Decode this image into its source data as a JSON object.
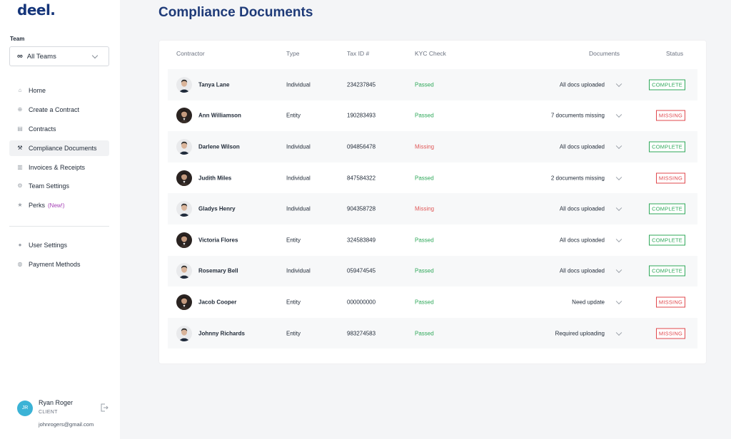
{
  "sidebar": {
    "logo": "deel.",
    "team_label": "Team",
    "team_select": {
      "icon": "∞",
      "value": "All Teams"
    },
    "nav": [
      {
        "label": "Home",
        "icon": "home-icon"
      },
      {
        "label": "Create a Contract",
        "icon": "plus-circle-icon"
      },
      {
        "label": "Contracts",
        "icon": "document-icon"
      },
      {
        "label": "Compliance Documents",
        "icon": "hammer-icon",
        "active": true
      },
      {
        "label": "Invoices & Receipts",
        "icon": "receipt-icon"
      },
      {
        "label": "Team Settings",
        "icon": "gear-icon"
      },
      {
        "label": "Perks",
        "icon": "star-icon",
        "badge": "(New!)"
      }
    ],
    "nav2": [
      {
        "label": "User Settings",
        "icon": "user-icon"
      },
      {
        "label": "Payment Methods",
        "icon": "card-icon"
      }
    ],
    "user": {
      "initials": "JR",
      "name": "Ryan Roger",
      "role": "CLIENT",
      "email": "johnrogers@gmail.com"
    }
  },
  "main": {
    "title": "Compliance Documents",
    "columns": {
      "contractor": "Contractor",
      "type": "Type",
      "tax_id": "Tax ID #",
      "kyc": "KYC Check",
      "documents": "Documents",
      "status": "Status"
    },
    "rows": [
      {
        "name": "Tanya Lane",
        "type": "Individual",
        "tax_id": "234237845",
        "kyc": "Passed",
        "documents": "All docs uploaded",
        "status": "COMPLETE",
        "avatar": "light"
      },
      {
        "name": "Ann Williamson",
        "type": "Entity",
        "tax_id": "190283493",
        "kyc": "Passed",
        "documents": "7 documents missing",
        "status": "MISSING",
        "avatar": "dark"
      },
      {
        "name": "Darlene Wilson",
        "type": "Individual",
        "tax_id": "094856478",
        "kyc": "Missing",
        "documents": "All docs uploaded",
        "status": "COMPLETE",
        "avatar": "light"
      },
      {
        "name": "Judith Miles",
        "type": "Individual",
        "tax_id": "847584322",
        "kyc": "Passed",
        "documents": "2 documents missing",
        "status": "MISSING",
        "avatar": "dark"
      },
      {
        "name": "Gladys Henry",
        "type": "Individual",
        "tax_id": "904358728",
        "kyc": "Missing",
        "documents": "All docs uploaded",
        "status": "COMPLETE",
        "avatar": "light"
      },
      {
        "name": "Victoria Flores",
        "type": "Entity",
        "tax_id": "324583849",
        "kyc": "Passed",
        "documents": "All docs uploaded",
        "status": "COMPLETE",
        "avatar": "dark"
      },
      {
        "name": "Rosemary Bell",
        "type": "Individual",
        "tax_id": "059474545",
        "kyc": "Passed",
        "documents": "All docs uploaded",
        "status": "COMPLETE",
        "avatar": "light"
      },
      {
        "name": "Jacob Cooper",
        "type": "Entity",
        "tax_id": "000000000",
        "kyc": "Passed",
        "documents": "Need update",
        "status": "MISSING",
        "avatar": "dark"
      },
      {
        "name": "Johnny Richards",
        "type": "Entity",
        "tax_id": "983274583",
        "kyc": "Passed",
        "documents": "Required uploading",
        "status": "MISSING",
        "avatar": "light"
      }
    ]
  },
  "colors": {
    "brand": "#15357a",
    "title": "#1e3a78",
    "passed": "#2fa85a",
    "missing": "#e0484d",
    "perks_new": "#a43fb5",
    "avatar": "#3bb3d6"
  }
}
